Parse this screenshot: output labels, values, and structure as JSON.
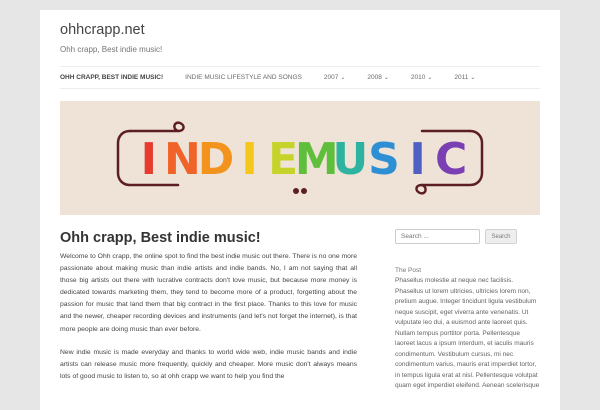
{
  "site": {
    "title": "ohhcrapp.net",
    "tagline": "Ohh crapp, Best indie music!"
  },
  "nav": {
    "items": [
      {
        "label": "OHH CRAPP, BEST INDIE MUSIC!"
      },
      {
        "label": "INDIE MUSIC LIFESTYLE AND SONGS"
      },
      {
        "label": "2007"
      },
      {
        "label": "2008"
      },
      {
        "label": "2010"
      },
      {
        "label": "2011"
      }
    ],
    "caret": "⌄"
  },
  "banner": {
    "text": "INDIEMUSIC",
    "background_color": "#efe3d7",
    "frame_color": "#5b1f23",
    "letter_colors": [
      "#e63b2e",
      "#f0642a",
      "#f2931d",
      "#f5c61c",
      "#c5d32a",
      "#5fbf3c",
      "#2fb3a1",
      "#2f8fd4",
      "#4f5fc4",
      "#7a3fb2"
    ]
  },
  "post": {
    "title": "Ohh crapp, Best indie music!",
    "paragraphs": [
      "Welcome to Ohh crapp, the online spot to find the best indie music out there. There is no one more passionate about making music than indie artists and indie bands. No, I am not saying that all those big artists out there with lucrative contracts don't love music, but because more money is dedicated towards marketing them, they tend to become more of a product, forgetting about the passion for music that land them that big contract in the first place. Thanks to this love for music and the newer, cheaper recording devices and instruments (and let's not forget the internet), is that more people are doing music than ever before.",
      "New indie music is made everyday and thanks to world wide web, indie music bands and indie artists can release music more frequently, quickly and cheaper. More music don't always means lots of good music to listen to, so at ohh crapp we want to help you find the"
    ]
  },
  "sidebar": {
    "search_placeholder": "Search ...",
    "search_button": "Search",
    "widget_title": "The Post",
    "widget_text": "Phasellus molestie at neque nec facilisis. Phasellus ut lorem ultricies, ultricies lorem non, pretium augue. Integer tincidunt ligula vestibulum neque suscipit, eget viverra ante venenatis. Ut vulputate leo dui, a euismod ante laoreet quis. Nullam tempus porttitor porta. Pellentesque laoreet lacus a ipsum interdum, et iaculis mauris condimentum. Vestibulum cursus, mi nec condimentum varius, mauris erat imperdiet tortor, in tempus ligula erat at nisl. Pellentesque volutpat quam eget imperdiet eleifend. Aenean scelerisque"
  }
}
